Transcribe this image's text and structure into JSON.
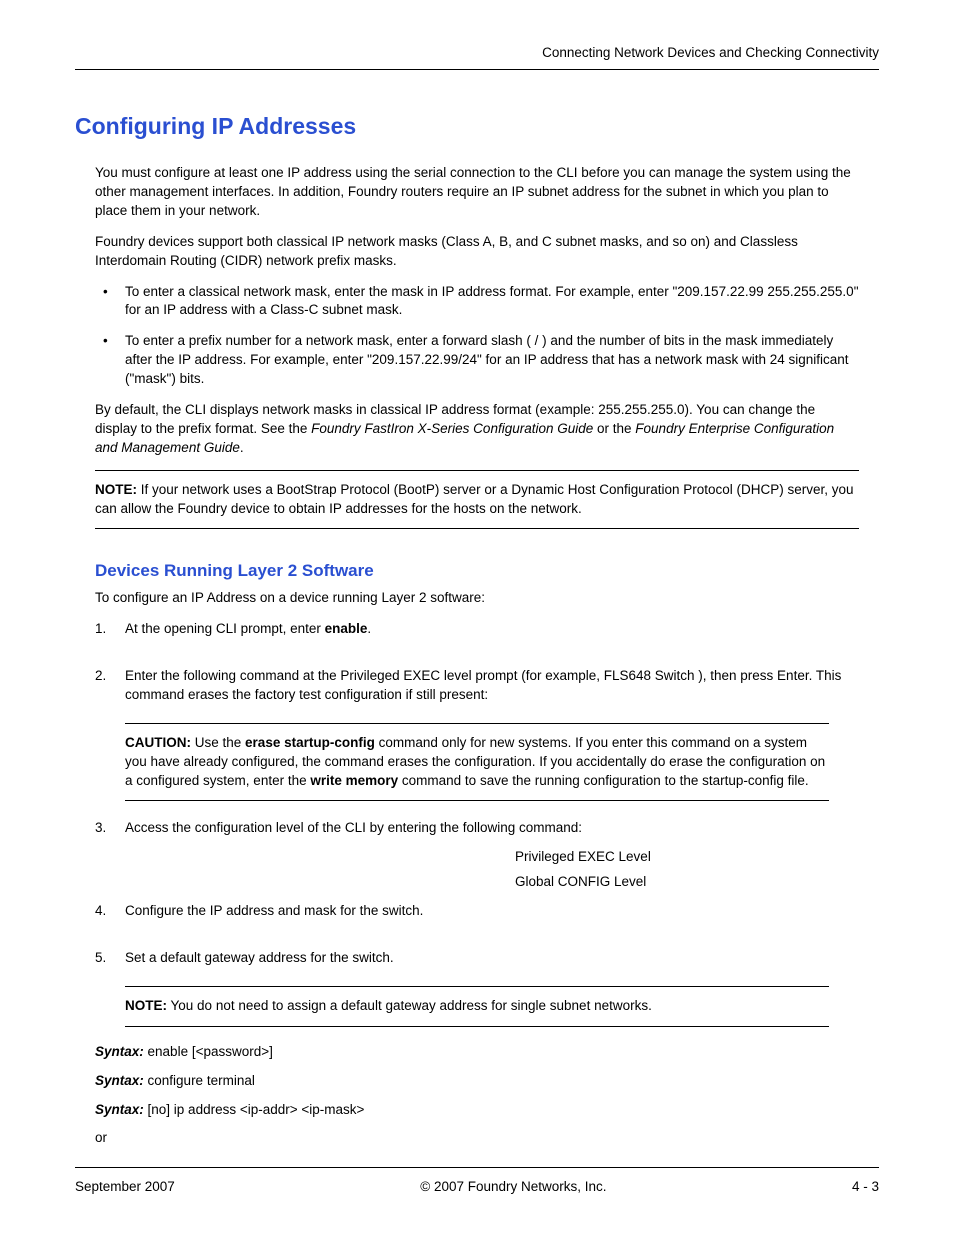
{
  "header": {
    "running_head": "Connecting Network Devices and Checking Connectivity"
  },
  "title": "Configuring IP Addresses",
  "intro": {
    "p1": "You must configure at least one IP address using the serial connection to the CLI before you can manage the system using the other management interfaces.  In addition, Foundry routers require an IP subnet address for the subnet in which you plan to place them in your network.",
    "p2": "Foundry devices support both classical IP network masks (Class A, B, and C subnet masks, and so on) and Classless Interdomain Routing (CIDR) network prefix masks.",
    "bullet1": "To enter a classical network mask, enter the mask in IP address format.  For example, enter \"209.157.22.99 255.255.255.0\" for an IP address with a Class-C subnet mask.",
    "bullet2": "To enter a prefix number for a network mask, enter a forward slash ( / ) and the number of bits in the mask immediately after the IP address.  For example, enter \"209.157.22.99/24\" for an IP address that has a network mask with 24 significant (\"mask\") bits.",
    "p3a": "By default, the CLI displays network masks in classical IP address format (example: 255.255.255.0).  You can change the display to the prefix format.  See the ",
    "p3_em1": "Foundry FastIron X-Series Configuration Guide",
    "p3b": " or the ",
    "p3_em2": "Foundry Enterprise Configuration and Management Guide",
    "p3c": "."
  },
  "note1": {
    "label": "NOTE:",
    "text": "If your network uses a BootStrap Protocol (BootP) server or a Dynamic Host Configuration Protocol (DHCP) server, you can allow the Foundry device to obtain IP addresses for the hosts on the network."
  },
  "section2": {
    "title": "Devices Running Layer 2 Software",
    "lead": "To configure an IP Address on a device running Layer 2 software:",
    "step1a": "At the opening CLI prompt, enter ",
    "step1_bold": "enable",
    "step1b": ".",
    "step2": "Enter the following command at the Privileged EXEC level prompt (for example, FLS648 Switch ), then press Enter.  This command erases the factory test configuration if still present:",
    "caution_label": "CAUTION:",
    "caution_a": "Use the ",
    "caution_b1": "erase startup-config",
    "caution_b": " command only for new systems.  If you enter this command on a system you have already configured, the command erases the configuration.  If you accidentally do erase the configuration on a configured system, enter the ",
    "caution_b2": "write memory",
    "caution_c": " command to save the running configuration to the startup-config file.",
    "step3": "Access the configuration level of the CLI by entering the following command:",
    "level1": "Privileged EXEC Level",
    "level2": "Global CONFIG Level",
    "step4": "Configure the IP address and mask for the switch.",
    "step5": "Set a default gateway address for the switch.",
    "note2_label": "NOTE:",
    "note2_text": "You do not need to assign a default gateway address for single subnet networks.",
    "syntax_label": "Syntax:",
    "syntax1": " enable [<password>]",
    "syntax2": " configure terminal",
    "syntax3": " [no] ip address <ip-addr> <ip-mask>",
    "or": " or"
  },
  "footer": {
    "left": "September 2007",
    "center": "© 2007 Foundry Networks, Inc.",
    "right": "4 - 3"
  }
}
